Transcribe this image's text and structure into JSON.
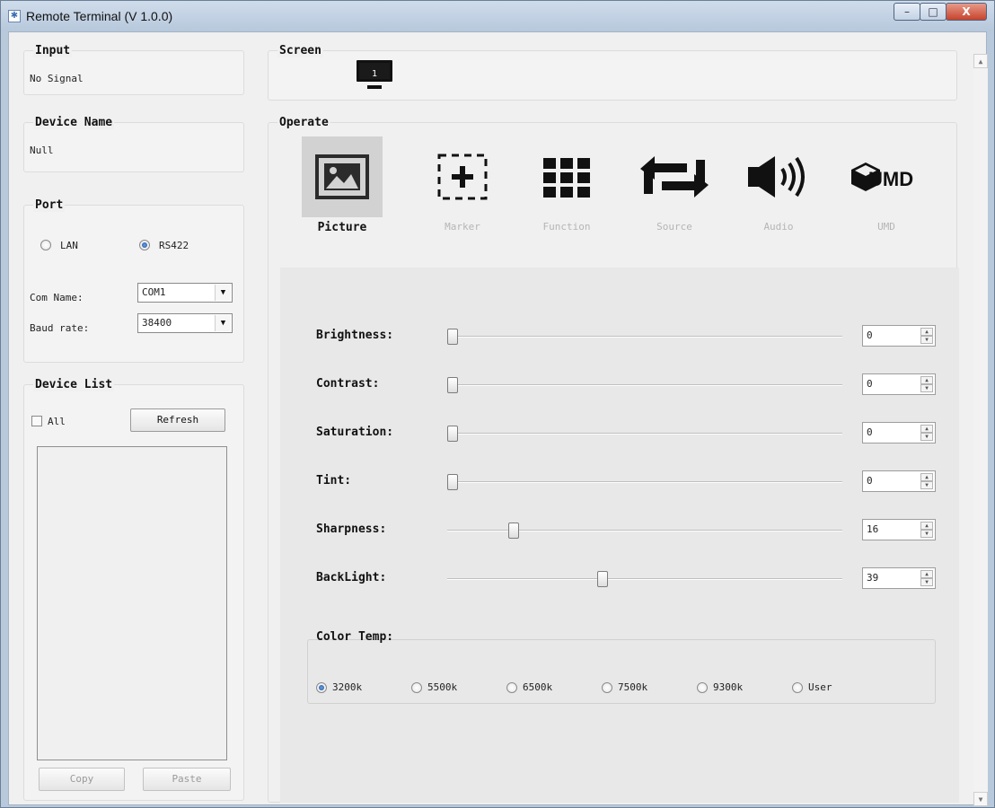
{
  "window": {
    "title": "Remote Terminal (V 1.0.0)",
    "minimize": "–",
    "maximize": "□",
    "close": "X"
  },
  "input": {
    "title": "Input",
    "value": "No Signal"
  },
  "device_name": {
    "title": "Device Name",
    "value": "Null"
  },
  "port": {
    "title": "Port",
    "lan_label": "LAN",
    "rs422_label": "RS422",
    "com_label": "Com Name:",
    "com_value": "COM1",
    "baud_label": "Baud rate:",
    "baud_value": "38400"
  },
  "device_list": {
    "title": "Device List",
    "all_label": "All",
    "refresh_label": "Refresh",
    "copy_label": "Copy",
    "paste_label": "Paste"
  },
  "screen": {
    "title": "Screen",
    "number": "1"
  },
  "operate": {
    "title": "Operate",
    "items": [
      {
        "label": "Picture",
        "icon": "picture-icon",
        "selected": true
      },
      {
        "label": "Marker",
        "icon": "marker-icon",
        "selected": false
      },
      {
        "label": "Function",
        "icon": "function-icon",
        "selected": false
      },
      {
        "label": "Source",
        "icon": "source-icon",
        "selected": false
      },
      {
        "label": "Audio",
        "icon": "audio-icon",
        "selected": false
      },
      {
        "label": "UMD",
        "icon": "umd-icon",
        "selected": false
      }
    ],
    "umd_icon_text": "UMD"
  },
  "picture": {
    "sliders": [
      {
        "label": "Brightness:",
        "value": "0",
        "fraction": 0
      },
      {
        "label": "Contrast:",
        "value": "0",
        "fraction": 0
      },
      {
        "label": "Saturation:",
        "value": "0",
        "fraction": 0
      },
      {
        "label": "Tint:",
        "value": "0",
        "fraction": 0
      },
      {
        "label": "Sharpness:",
        "value": "16",
        "fraction": 0.16
      },
      {
        "label": "BackLight:",
        "value": "39",
        "fraction": 0.39
      }
    ],
    "color_temp": {
      "title": "Color Temp:",
      "options": [
        "3200k",
        "5500k",
        "6500k",
        "7500k",
        "9300k",
        "User"
      ],
      "selected": "3200k"
    }
  }
}
